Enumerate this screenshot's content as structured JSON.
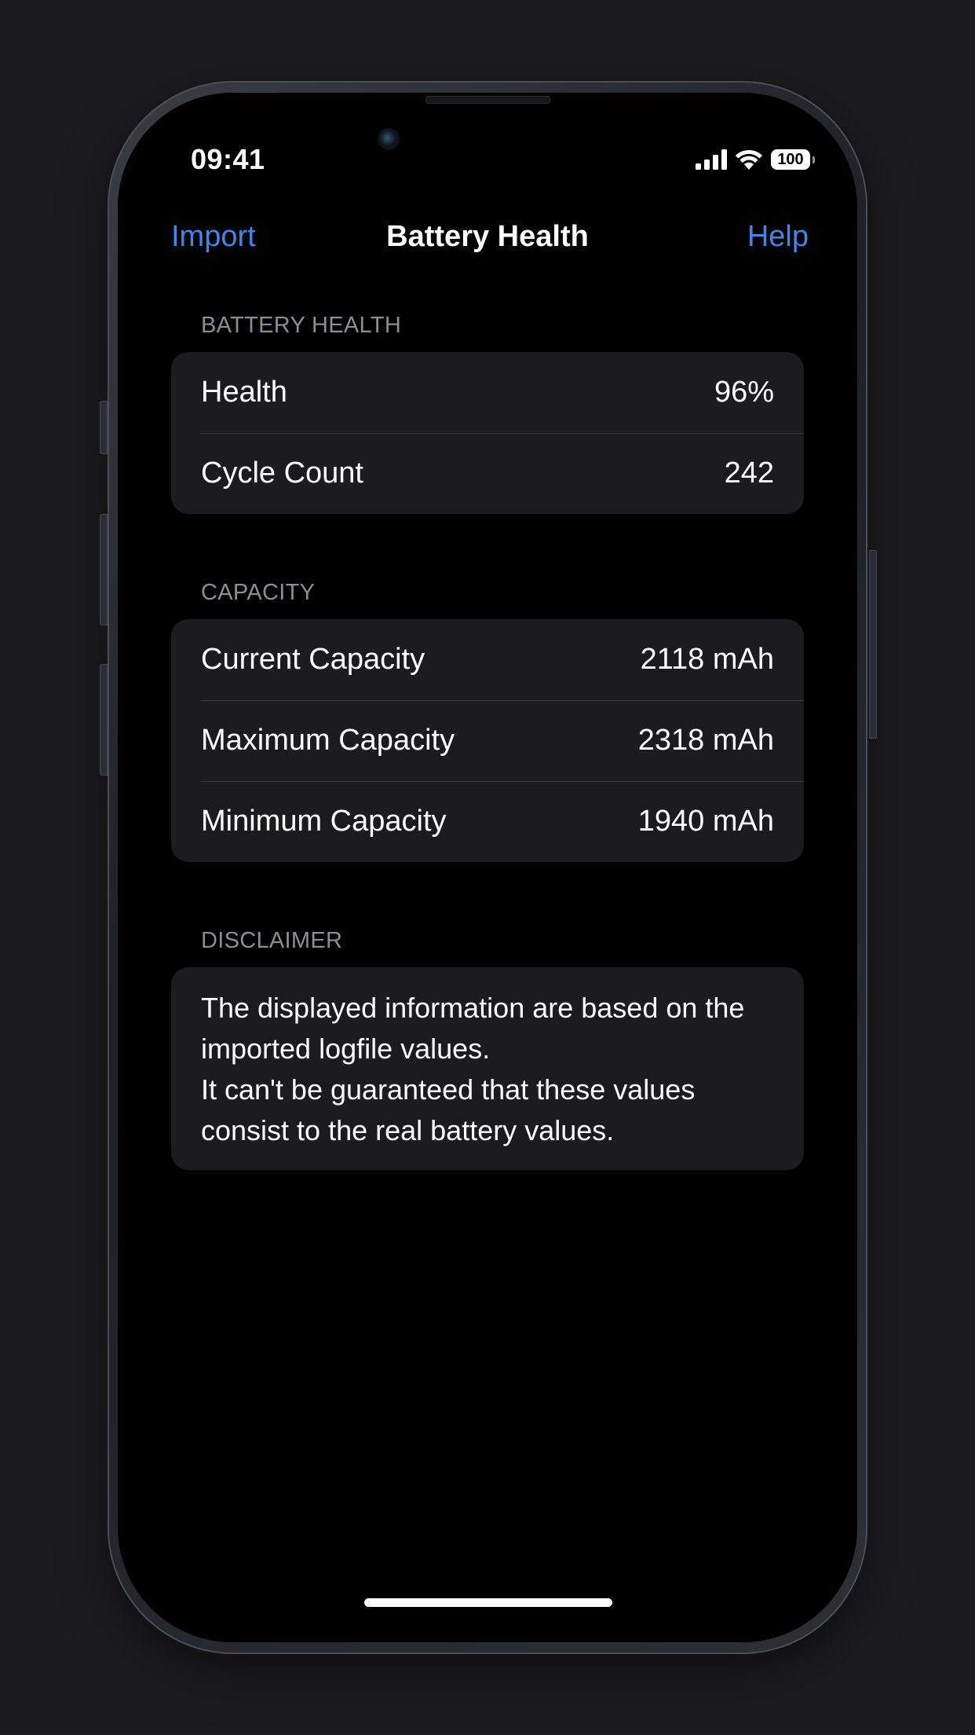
{
  "status_bar": {
    "time": "09:41",
    "battery_level": "100"
  },
  "nav": {
    "left_label": "Import",
    "title": "Battery Health",
    "right_label": "Help"
  },
  "sections": {
    "battery_health": {
      "header": "BATTERY HEALTH",
      "rows": [
        {
          "label": "Health",
          "value": "96%"
        },
        {
          "label": "Cycle Count",
          "value": "242"
        }
      ]
    },
    "capacity": {
      "header": "CAPACITY",
      "rows": [
        {
          "label": "Current Capacity",
          "value": "2118 mAh"
        },
        {
          "label": "Maximum Capacity",
          "value": "2318 mAh"
        },
        {
          "label": "Minimum Capacity",
          "value": "1940 mAh"
        }
      ]
    },
    "disclaimer": {
      "header": "DISCLAIMER",
      "line1": "The displayed information are based on the imported logfile values.",
      "line2": "It can't be guaranteed that these values consist to the real battery values."
    }
  },
  "colors": {
    "accent": "#3e86ec",
    "background": "#000000",
    "grouped_cell": "#1c1c1e",
    "secondary_text": "#8d8d93"
  },
  "icons": [
    "cellular-signal-icon",
    "wifi-icon",
    "battery-icon"
  ]
}
